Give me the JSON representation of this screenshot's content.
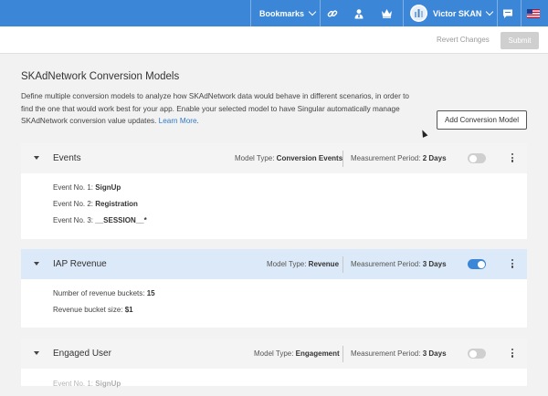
{
  "topbar": {
    "bookmarks_label": "Bookmarks",
    "user_name": "Victor SKAN",
    "accent_color": "#3b86d6"
  },
  "actions": {
    "revert_label": "Revert Changes",
    "submit_label": "Submit"
  },
  "page": {
    "title": "SKAdNetwork Conversion Models",
    "description": "Define multiple conversion models to analyze how SKAdNetwork data would behave in different scenarios, in order to find the one that would work best for your app. Enable your selected model to have Singular automatically manage SKAdNetwork conversion value updates.",
    "learn_more": "Learn More",
    "period": ".",
    "add_button": "Add Conversion Model"
  },
  "labels": {
    "model_type": "Model Type:",
    "measurement_period": "Measurement Period:"
  },
  "models": [
    {
      "name": "Events",
      "model_type": "Conversion Events",
      "period": "2 Days",
      "enabled": false,
      "details": [
        {
          "label": "Event No. 1:",
          "value": "SignUp"
        },
        {
          "label": "Event No. 2:",
          "value": "Registration"
        },
        {
          "label": "Event No. 3:",
          "value": "__SESSION__*"
        }
      ]
    },
    {
      "name": "IAP Revenue",
      "model_type": "Revenue",
      "period": "3 Days",
      "enabled": true,
      "details": [
        {
          "label": "Number of revenue buckets:",
          "value": "15"
        },
        {
          "label": "Revenue bucket size:",
          "value": "$1"
        }
      ]
    },
    {
      "name": "Engaged User",
      "model_type": "Engagement",
      "period": "3 Days",
      "enabled": false,
      "details": [
        {
          "label": "Event No. 1:",
          "value": "SignUp"
        }
      ]
    }
  ]
}
